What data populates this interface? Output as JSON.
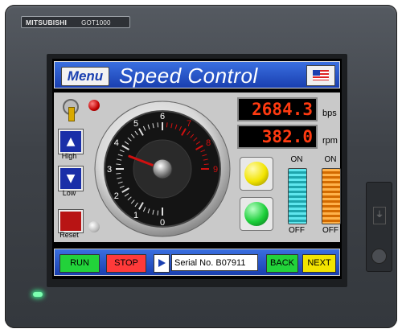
{
  "device": {
    "brand": "MITSUBISHI",
    "model": "GOT1000"
  },
  "header": {
    "menu_label": "Menu",
    "title": "Speed Control",
    "flag_icon": "us-flag-icon"
  },
  "controls": {
    "high_label": "High",
    "low_label": "Low",
    "reset_label": "Reset"
  },
  "gauge": {
    "ticks": [
      "0",
      "1",
      "2",
      "3",
      "4",
      "5",
      "6",
      "7",
      "8",
      "9"
    ],
    "min": 0,
    "max": 9,
    "needle_value": 3.7,
    "accent_color": "#d01010"
  },
  "readouts": {
    "speed_bps": "2684.3",
    "speed_bps_unit": "bps",
    "speed_rpm": "382.0",
    "speed_rpm_unit": "rpm",
    "digit_color": "#ff3a10"
  },
  "lamps": {
    "yellow": "#f2e400",
    "green": "#1ccf3a"
  },
  "switches": [
    {
      "on_label": "ON",
      "off_label": "OFF",
      "color": "#23c6d0"
    },
    {
      "on_label": "ON",
      "off_label": "OFF",
      "color": "#ff8c00"
    }
  ],
  "toolbar": {
    "run_label": "RUN",
    "stop_label": "STOP",
    "serial_text": "Serial No. B07911",
    "back_label": "BACK",
    "next_label": "NEXT"
  }
}
